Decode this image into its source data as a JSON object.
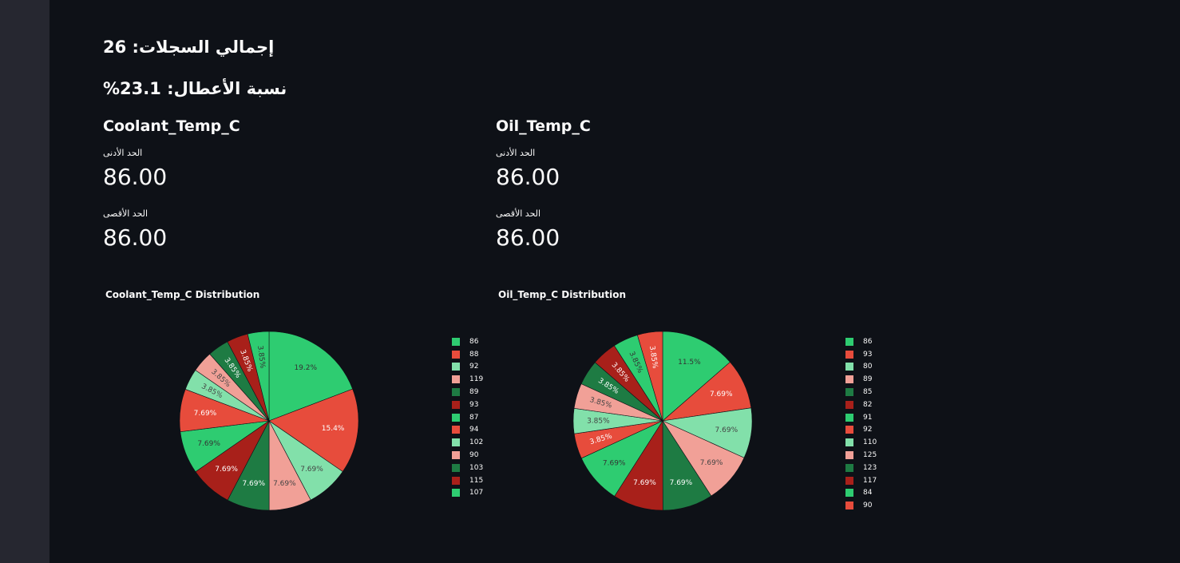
{
  "stats": {
    "total_records": "إجمالي السجلات: 26",
    "fault_rate": "نسبة الأعطال: 23.1%"
  },
  "metrics": [
    {
      "name": "Coolant_Temp_C",
      "min_label": "الحد الأدنى",
      "min_value": "86.00",
      "max_label": "الحد الأقصى",
      "max_value": "86.00"
    },
    {
      "name": "Oil_Temp_C",
      "min_label": "الحد الأدنى",
      "min_value": "86.00",
      "max_label": "الحد الأقصى",
      "max_value": "86.00"
    }
  ],
  "chart_data": [
    {
      "type": "pie",
      "title": "Coolant_Temp_C Distribution",
      "slices": [
        {
          "label": "86",
          "value": 19.2,
          "color": "#2ecc71"
        },
        {
          "label": "88",
          "value": 15.4,
          "color": "#e74c3c"
        },
        {
          "label": "92",
          "value": 7.69,
          "color": "#82e0aa"
        },
        {
          "label": "119",
          "value": 7.69,
          "color": "#f1a097"
        },
        {
          "label": "89",
          "value": 7.69,
          "color": "#1e7b43"
        },
        {
          "label": "93",
          "value": 7.69,
          "color": "#a8201a"
        },
        {
          "label": "87",
          "value": 7.69,
          "color": "#2ecc71"
        },
        {
          "label": "94",
          "value": 7.69,
          "color": "#e74c3c"
        },
        {
          "label": "102",
          "value": 3.85,
          "color": "#82e0aa"
        },
        {
          "label": "90",
          "value": 3.85,
          "color": "#f1a097"
        },
        {
          "label": "103",
          "value": 3.85,
          "color": "#1e7b43"
        },
        {
          "label": "115",
          "value": 3.85,
          "color": "#a8201a"
        },
        {
          "label": "107",
          "value": 3.85,
          "color": "#2ecc71"
        }
      ]
    },
    {
      "type": "pie",
      "title": "Oil_Temp_C Distribution",
      "slices": [
        {
          "label": "86",
          "value": 11.5,
          "color": "#2ecc71"
        },
        {
          "label": "93",
          "value": 7.69,
          "color": "#e74c3c"
        },
        {
          "label": "80",
          "value": 7.69,
          "color": "#82e0aa"
        },
        {
          "label": "89",
          "value": 7.69,
          "color": "#f1a097"
        },
        {
          "label": "85",
          "value": 7.69,
          "color": "#1e7b43"
        },
        {
          "label": "82",
          "value": 7.69,
          "color": "#a8201a"
        },
        {
          "label": "91",
          "value": 7.69,
          "color": "#2ecc71"
        },
        {
          "label": "92",
          "value": 3.85,
          "color": "#e74c3c"
        },
        {
          "label": "110",
          "value": 3.85,
          "color": "#82e0aa"
        },
        {
          "label": "125",
          "value": 3.85,
          "color": "#f1a097"
        },
        {
          "label": "123",
          "value": 3.85,
          "color": "#1e7b43"
        },
        {
          "label": "117",
          "value": 3.85,
          "color": "#a8201a"
        },
        {
          "label": "84",
          "value": 3.85,
          "color": "#2ecc71"
        },
        {
          "label": "90",
          "value": 3.85,
          "color": "#e74c3c"
        }
      ]
    }
  ]
}
